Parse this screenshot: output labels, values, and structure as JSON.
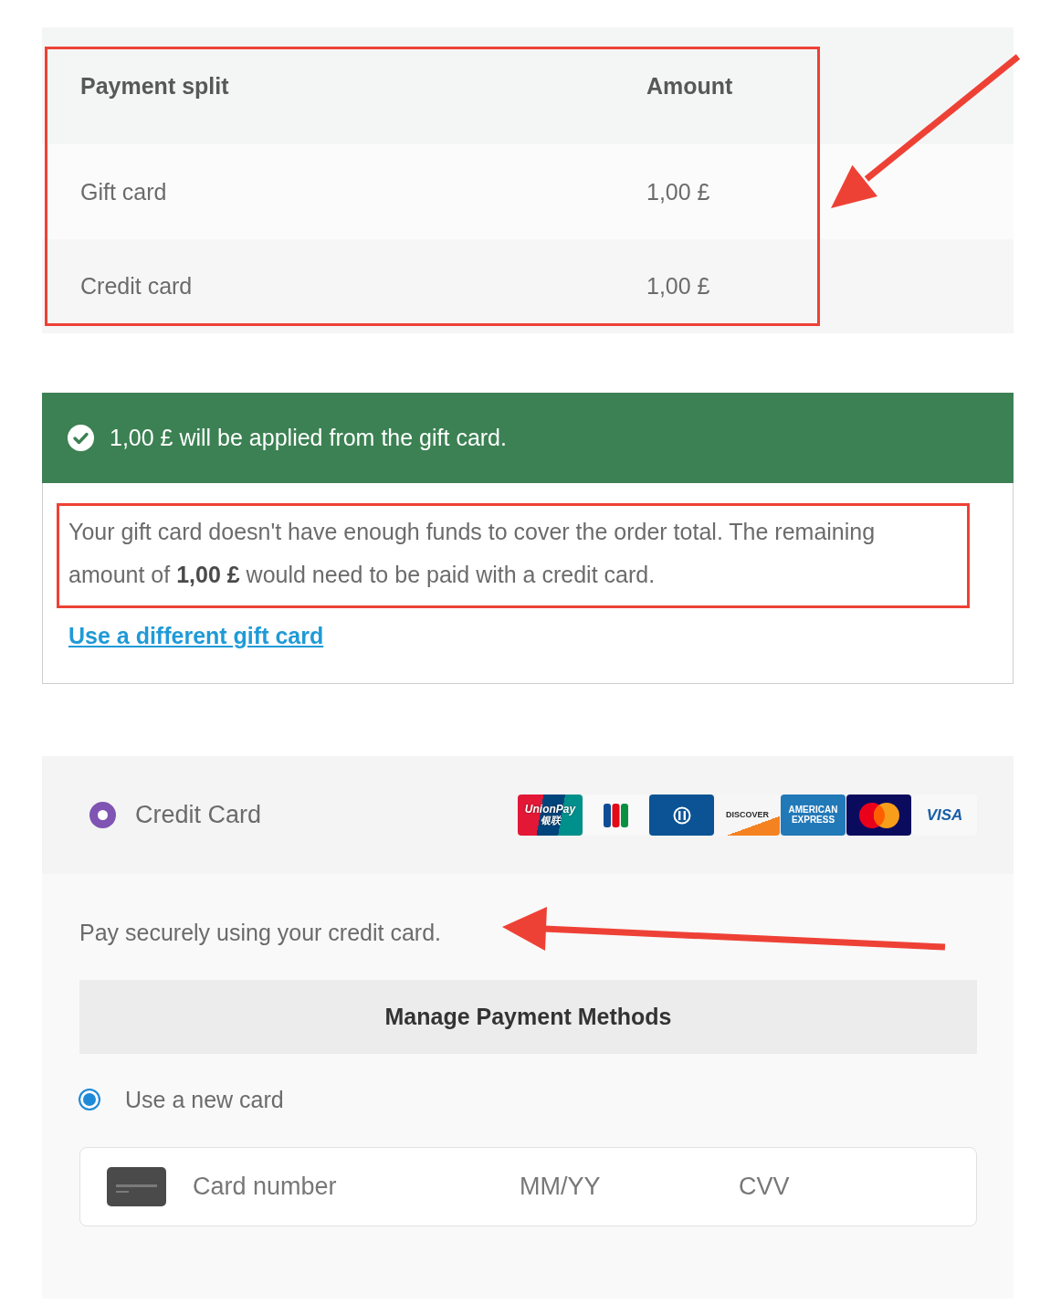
{
  "split_table": {
    "columns": [
      "Payment split",
      "Amount"
    ],
    "rows": [
      {
        "method": "Gift card",
        "amount": "1,00 £"
      },
      {
        "method": "Credit card",
        "amount": "1,00 £"
      }
    ]
  },
  "gift_card_notice": {
    "kind": "success",
    "message": "1,00 £ will be applied from the gift card.",
    "details": "Your gift card doesn't have enough funds to cover the order total. The remaining amount of **1,00 £** would need to be paid with a credit card.",
    "link": "Use a different gift card"
  },
  "payment_method": {
    "label": "Credit Card",
    "selected": true,
    "card_logos": [
      {
        "kind": "unionpay",
        "texts": [
          "UnionPay",
          "银联"
        ]
      },
      {
        "kind": "jcb"
      },
      {
        "kind": "diners"
      },
      {
        "kind": "discover",
        "texts": [
          "DISCOVER"
        ]
      },
      {
        "kind": "amex",
        "texts": [
          "AMERICAN EXPRESS"
        ]
      },
      {
        "kind": "mastercard"
      },
      {
        "kind": "visa",
        "texts": [
          "VISA"
        ]
      }
    ],
    "description": "Pay securely using your credit card.",
    "manage_button": "Manage Payment Methods",
    "options": [
      {
        "label": "Use a new card",
        "selected": true
      }
    ],
    "card_field": {
      "number_placeholder": "Card number",
      "expiry_placeholder": "MM/YY",
      "cvv_placeholder": "CVV"
    }
  }
}
